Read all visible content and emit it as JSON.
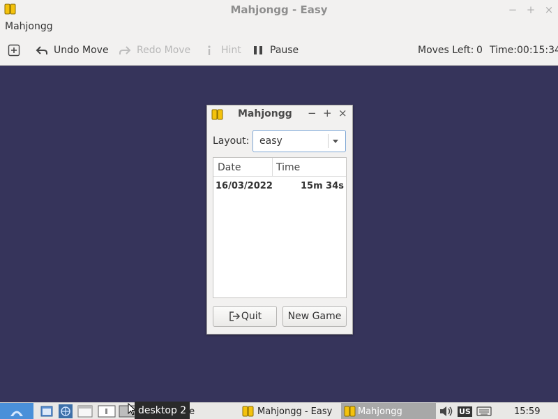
{
  "window": {
    "title": "Mahjongg - Easy",
    "minimize_label": "−",
    "maximize_label": "+",
    "close_label": "×"
  },
  "menubar": {
    "app_menu_label": "Mahjongg"
  },
  "toolbar": {
    "new_game_icon": "plus-square-icon",
    "undo_label": "Undo Move",
    "redo_label": "Redo Move",
    "hint_label": "Hint",
    "pause_label": "Pause",
    "moves_left_label": "Moves Left:",
    "moves_left_value": "0",
    "time_label": "Time:",
    "time_value": "00:15:34"
  },
  "dialog": {
    "title": "Mahjongg",
    "minimize_label": "−",
    "maximize_label": "+",
    "close_label": "×",
    "layout_label": "Layout:",
    "layout_value": "easy",
    "columns": [
      "Date",
      "Time"
    ],
    "rows": [
      {
        "date": "16/03/2022",
        "time": "15m 34s"
      }
    ],
    "quit_label": "Quit",
    "new_game_label": "New Game"
  },
  "taskbar": {
    "tooltip": "desktop 2",
    "hidden_task_suffix": "te",
    "task_1_label": "Mahjongg - Easy",
    "task_2_label": "Mahjongg",
    "keyboard_layout": "US",
    "clock": "15:59"
  },
  "colors": {
    "game_background": "#36345b",
    "accent": "#7fa7d4",
    "tile_yellow": "#f4c20d"
  }
}
